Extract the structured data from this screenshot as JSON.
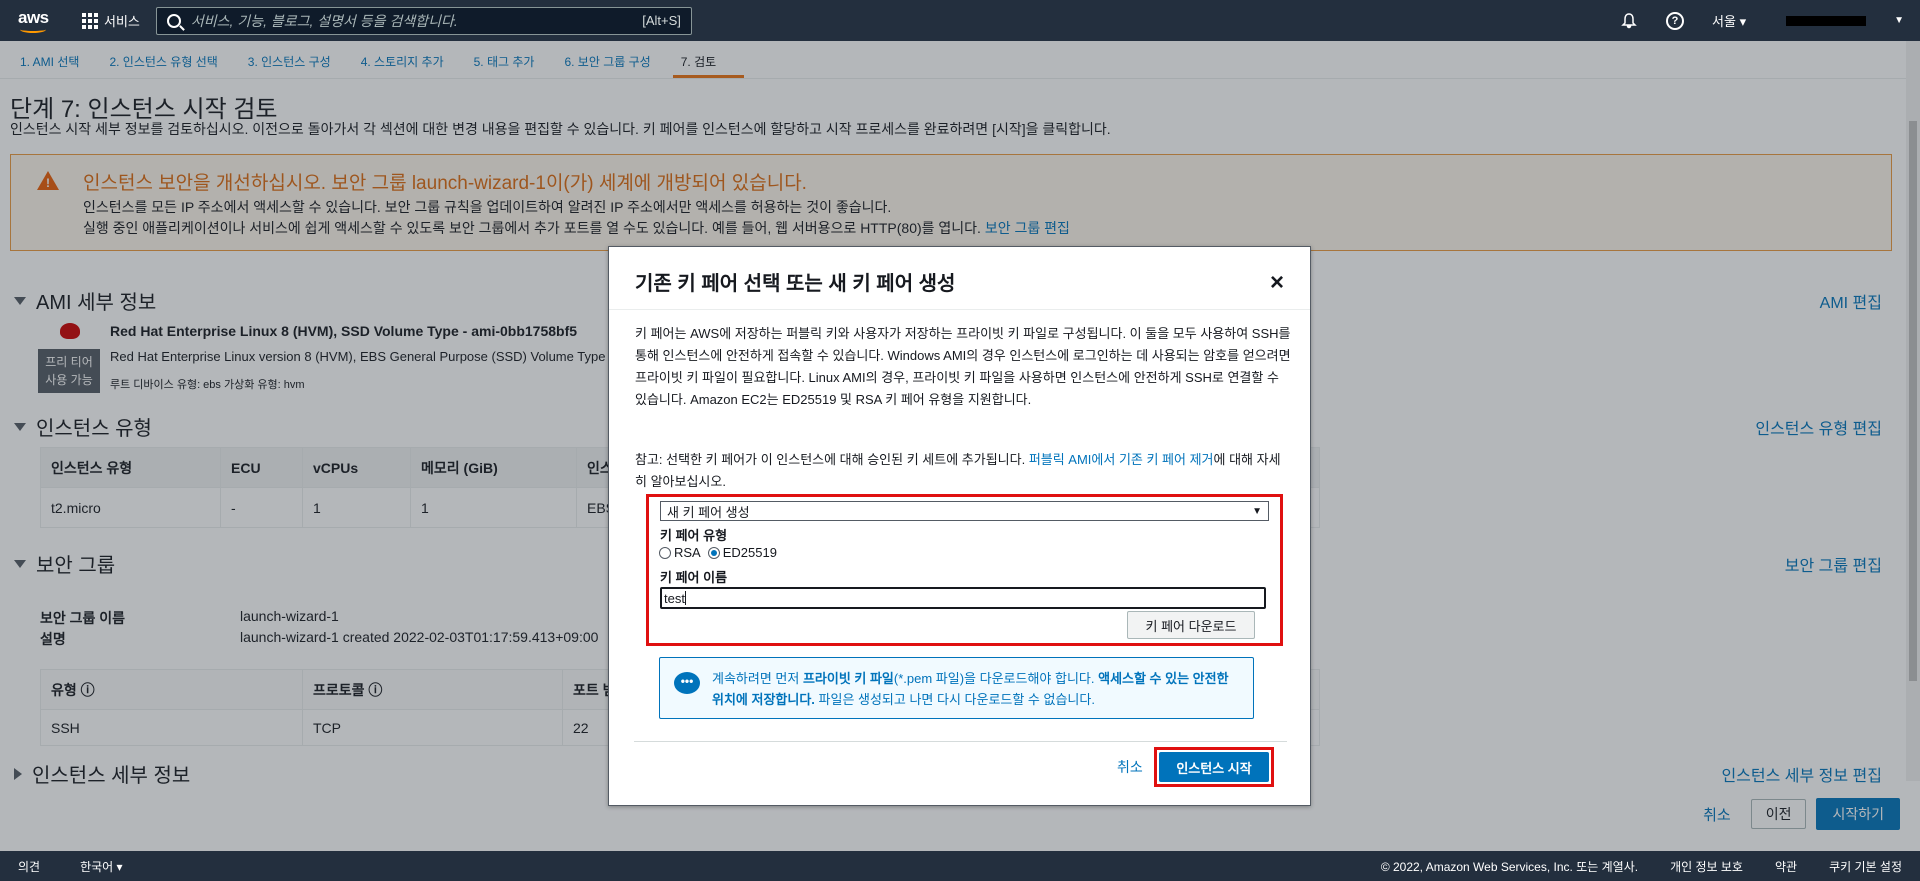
{
  "topnav": {
    "logo": "aws",
    "services": "서비스",
    "search_placeholder": "서비스, 기능, 블로그, 설명서 등을 검색합니다.",
    "search_shortcut": "[Alt+S]",
    "help": "?",
    "region": "서울 ▾"
  },
  "steps": [
    "1. AMI 선택",
    "2. 인스턴스 유형 선택",
    "3. 인스턴스 구성",
    "4. 스토리지 추가",
    "5. 태그 추가",
    "6. 보안 그룹 구성",
    "7. 검토"
  ],
  "page": {
    "title": "단계 7: 인스턴스 시작 검토",
    "subtitle": "인스턴스 시작 세부 정보를 검토하십시오. 이전으로 돌아가서 각 섹션에 대한 변경 내용을 편집할 수 있습니다. 키 페어를 인스턴스에 할당하고 시작 프로세스를 완료하려면 [시작]을 클릭합니다."
  },
  "warning": {
    "title": "인스턴스 보안을 개선하십시오. 보안 그룹 launch-wizard-1이(가) 세계에 개방되어 있습니다.",
    "line1": "인스턴스를 모든 IP 주소에서 액세스할 수 있습니다. 보안 그룹 규칙을 업데이트하여 알려진 IP 주소에서만 액세스를 허용하는 것이 좋습니다.",
    "line2": "실행 중인 애플리케이션이나 서비스에 쉽게 액세스할 수 있도록 보안 그룹에서 추가 포트를 열 수도 있습니다. 예를 들어, 웹 서버용으로 HTTP(80)를 엽니다.",
    "link": "보안 그룹 편집"
  },
  "ami": {
    "section": "AMI 세부 정보",
    "edit": "AMI 편집",
    "name": "Red Hat Enterprise Linux 8 (HVM), SSD Volume Type - ami-0bb1758bf5",
    "desc": "Red Hat Enterprise Linux version 8 (HVM), EBS General Purpose (SSD) Volume Type",
    "free_tier": "프리 티어\n사용 가능",
    "meta": "루트 디바이스 유형: ebs    가상화 유형: hvm"
  },
  "instance_type": {
    "section": "인스턴스 유형",
    "edit": "인스턴스 유형 편집",
    "headers": [
      "인스턴스 유형",
      "ECU",
      "vCPUs",
      "메모리 (GiB)",
      "인스"
    ],
    "row": [
      "t2.micro",
      "-",
      "1",
      "1",
      "EBS"
    ]
  },
  "security": {
    "section": "보안 그룹",
    "edit": "보안 그룹 편집",
    "name_label": "보안 그룹 이름",
    "name_value": "launch-wizard-1",
    "desc_label": "설명",
    "desc_value": "launch-wizard-1 created 2022-02-03T01:17:59.413+09:00",
    "headers": [
      "유형 ⓘ",
      "프로토콜 ⓘ",
      "포트 범"
    ],
    "row": [
      "SSH",
      "TCP",
      "22"
    ]
  },
  "instance_details": {
    "section": "인스턴스 세부 정보",
    "edit": "인스턴스 세부 정보 편집"
  },
  "bottom": {
    "cancel": "취소",
    "prev": "이전",
    "launch": "시작하기"
  },
  "modal": {
    "title": "기존 키 페어 선택 또는 새 키 페어 생성",
    "close": "×",
    "desc": "키 페어는 AWS에 저장하는 퍼블릭 키와 사용자가 저장하는 프라이빗 키 파일로 구성됩니다. 이 둘을 모두 사용하여 SSH를 통해 인스턴스에 안전하게 접속할 수 있습니다. Windows AMI의 경우 인스턴스에 로그인하는 데 사용되는 암호를 얻으려면 프라이빗 키 파일이 필요합니다. Linux AMI의 경우, 프라이빗 키 파일을 사용하면 인스턴스에 안전하게 SSH로 연결할 수 있습니다. Amazon EC2는 ED25519 및 RSA 키 페어 유형을 지원합니다.",
    "note_prefix": "참고: 선택한 키 페어가 이 인스턴스에 대해 승인된 키 세트에 추가됩니다.",
    "note_link": "퍼블릭 AMI에서 기존 키 페어 제거",
    "note_suffix": "에 대해 자세히 알아보십시오.",
    "select_value": "새 키 페어 생성",
    "type_label": "키 페어 유형",
    "rsa": "RSA",
    "ed": "ED25519",
    "name_label": "키 페어 이름",
    "name_value": "test",
    "download": "키 페어 다운로드",
    "info_a": "계속하려면 먼저 ",
    "info_b": "프라이빗 키 파일",
    "info_c": "(*.pem 파일)을 다운로드해야 합니다. ",
    "info_d": "액세스할 수 있는 안전한 위치에 저장합니다.",
    "info_e": " 파일은 생성되고 나면 다시 다운로드할 수 없습니다.",
    "cancel": "취소",
    "launch": "인스턴스 시작"
  },
  "footer": {
    "feedback": "의견",
    "lang": "한국어 ▾",
    "copyright": "© 2022, Amazon Web Services, Inc. 또는 계열사.",
    "privacy": "개인 정보 보호",
    "terms": "약관",
    "cookies": "쿠키 기본 설정"
  }
}
